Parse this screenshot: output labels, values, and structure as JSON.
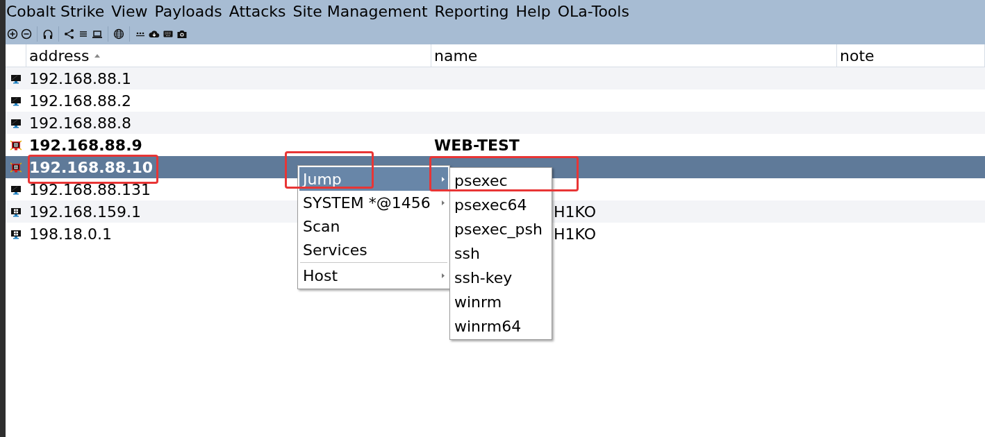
{
  "menu_bar": [
    {
      "label": "Cobalt Strike"
    },
    {
      "label": "View"
    },
    {
      "label": "Payloads"
    },
    {
      "label": "Attacks"
    },
    {
      "label": "Site Management"
    },
    {
      "label": "Reporting"
    },
    {
      "label": "Help"
    },
    {
      "label": "OLa-Tools"
    }
  ],
  "table": {
    "columns": [
      {
        "label": "address",
        "sorted": true
      },
      {
        "label": "name",
        "sorted": false
      },
      {
        "label": "note",
        "sorted": false
      }
    ],
    "rows": [
      {
        "kind": "monitor",
        "address": "192.168.88.1",
        "bold": false,
        "selected": false
      },
      {
        "kind": "monitor",
        "address": "192.168.88.2",
        "bold": false,
        "selected": false
      },
      {
        "kind": "monitor",
        "address": "192.168.88.8",
        "bold": false,
        "selected": false
      },
      {
        "kind": "compromised",
        "address": "192.168.88.9",
        "name": "WEB-TEST",
        "bold": true,
        "selected": false
      },
      {
        "kind": "compromised",
        "address": "192.168.88.10",
        "bold": true,
        "selected": true
      },
      {
        "kind": "monitor",
        "address": "192.168.88.131",
        "bold": false,
        "selected": false
      },
      {
        "kind": "windows",
        "address": "192.168.159.1",
        "name": "H1KO",
        "name_covered": true,
        "bold": false,
        "selected": false
      },
      {
        "kind": "windows",
        "address": "198.18.0.1",
        "name": "H1KO",
        "name_covered": true,
        "bold": false,
        "selected": false
      }
    ]
  },
  "context_menu": {
    "items": [
      {
        "kind": "item",
        "label": "Jump",
        "submenu": true,
        "selected": true
      },
      {
        "kind": "item",
        "label": "SYSTEM *@1456",
        "submenu": true,
        "selected": false
      },
      {
        "kind": "item",
        "label": "Scan",
        "submenu": false,
        "selected": false
      },
      {
        "kind": "item",
        "label": "Services",
        "submenu": false,
        "selected": false
      },
      {
        "kind": "separator"
      },
      {
        "kind": "item",
        "label": "Host",
        "submenu": true,
        "selected": false
      }
    ]
  },
  "submenu": {
    "items": [
      {
        "label": "psexec"
      },
      {
        "label": "psexec64"
      },
      {
        "label": "psexec_psh"
      },
      {
        "label": "ssh"
      },
      {
        "label": "ssh-key"
      },
      {
        "label": "winrm"
      },
      {
        "label": "winrm64"
      }
    ]
  },
  "annotations": [
    {
      "kind": "host_box"
    },
    {
      "kind": "menu_item_box"
    },
    {
      "kind": "submenu_item_box"
    }
  ]
}
